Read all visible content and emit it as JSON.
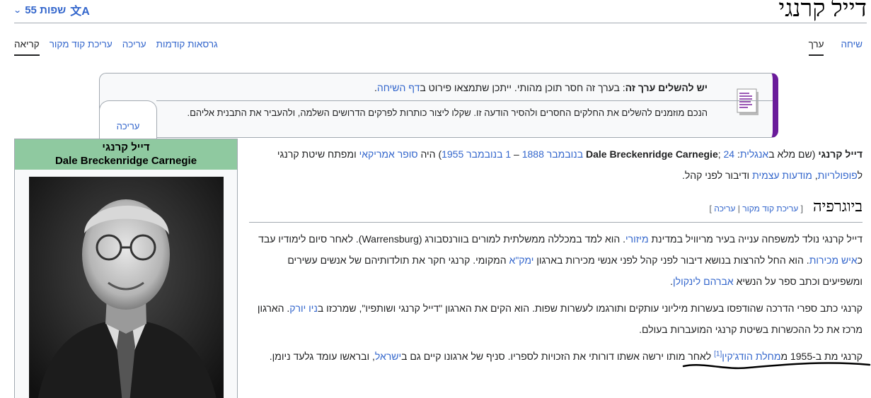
{
  "header": {
    "title": "דייל קרנגי",
    "languages_label": "55 שפות"
  },
  "tabs_right": [
    {
      "label": "ערך",
      "active": true
    },
    {
      "label": "שיחה",
      "active": false
    }
  ],
  "tabs_left": [
    {
      "label": "קריאה",
      "active": true
    },
    {
      "label": "עריכת קוד מקור",
      "active": false
    },
    {
      "label": "עריכה",
      "active": false
    },
    {
      "label": "גרסאות קודמות",
      "active": false
    }
  ],
  "notice": {
    "title_bold": "יש להשלים ערך זה",
    "title_rest": ": בערך זה חסר תוכן מהותי. ייתכן שתמצאו פירוט ב",
    "talk_link": "דף השיחה",
    "title_end": ".",
    "body": "הנכם מוזמנים להשלים את החלקים החסרים ולהסיר הודעה זו. שקלו ליצור כותרות לפרקים הדרושים השלמה, ולהעביר את התבנית אליהם.",
    "edit_label": "עריכה",
    "accent_color": "#6a1b9a"
  },
  "infobox": {
    "name_he": "דייל קרנגי",
    "name_en": "Dale Breckenridge Carnegie",
    "header_color": "#8fc9a0"
  },
  "intro": {
    "t1": "דייל קרנגי",
    "t2": " (שם מלא ב",
    "l_english": "אנגלית",
    "t3": ": ",
    "t4": "Dale Breckenridge Carnegie",
    "t5": "; ",
    "l_birth": "24 בנובמבר 1888",
    "t6": " – ",
    "l_death": "1 בנובמבר 1955",
    "t7": ") היה ",
    "l_writer": "סופר אמריקאי",
    "t8": " ומפתח שיטת קרנגי ל",
    "l_popularity": "פופולריות",
    "t9": ", ",
    "l_self": "מודעות עצמית",
    "t10": " ודיבור לפני קהל."
  },
  "section": {
    "title": "ביוגרפיה",
    "edit_open": "[ ",
    "edit_source": "עריכת קוד מקור",
    "edit_sep": " | ",
    "edit": "עריכה",
    "edit_close": " ]"
  },
  "p1": {
    "a": "דייל קרנגי נולד למשפחה ענייה בעיר מריוויל במדינת ",
    "l_missouri": "מיזורי",
    "b": ". הוא למד במכללה ממשלתית למורים בוורנסבורג (Warrensburg). לאחר סיום לימודיו עבד כ",
    "l_sales": "איש מכירות",
    "c": ". הוא החל להרצות בנושא דיבור לפני קהל לפני אנשי מכירות בארגון ",
    "l_ymca": "ימק\"א",
    "d": " המקומי. קרנגי חקר את תולדותיהם של אנשים עשירים ומשפיעים וכתב ספר על הנשיא ",
    "l_lincoln": "אברהם לינקולן",
    "e": "."
  },
  "p2": {
    "a": "קרנגי כתב ספרי הדרכה שהודפסו בעשרות מיליוני עותקים ותורגמו לעשרות שפות. הוא הקים את הארגון \"דייל קרנגי ושותפיו\", שמרכזו ב",
    "l_ny": "ניו יורק",
    "b": ". הארגון מרכז את כל ההכשרות בשיטת קרנגי המועברות בעולם."
  },
  "p3": {
    "a": "קרנגי מת ב-1955 מ",
    "l_hodgkin": "מחלת הודג'קין",
    "ref": "[1]",
    "b": " לאחר מותו ירשה אשתו דורותי את הזכויות לספריו. סניף של ארגונו קיים גם ב",
    "l_israel": "ישראל",
    "c": ", ובראשו עומד גלעד ניומן."
  }
}
